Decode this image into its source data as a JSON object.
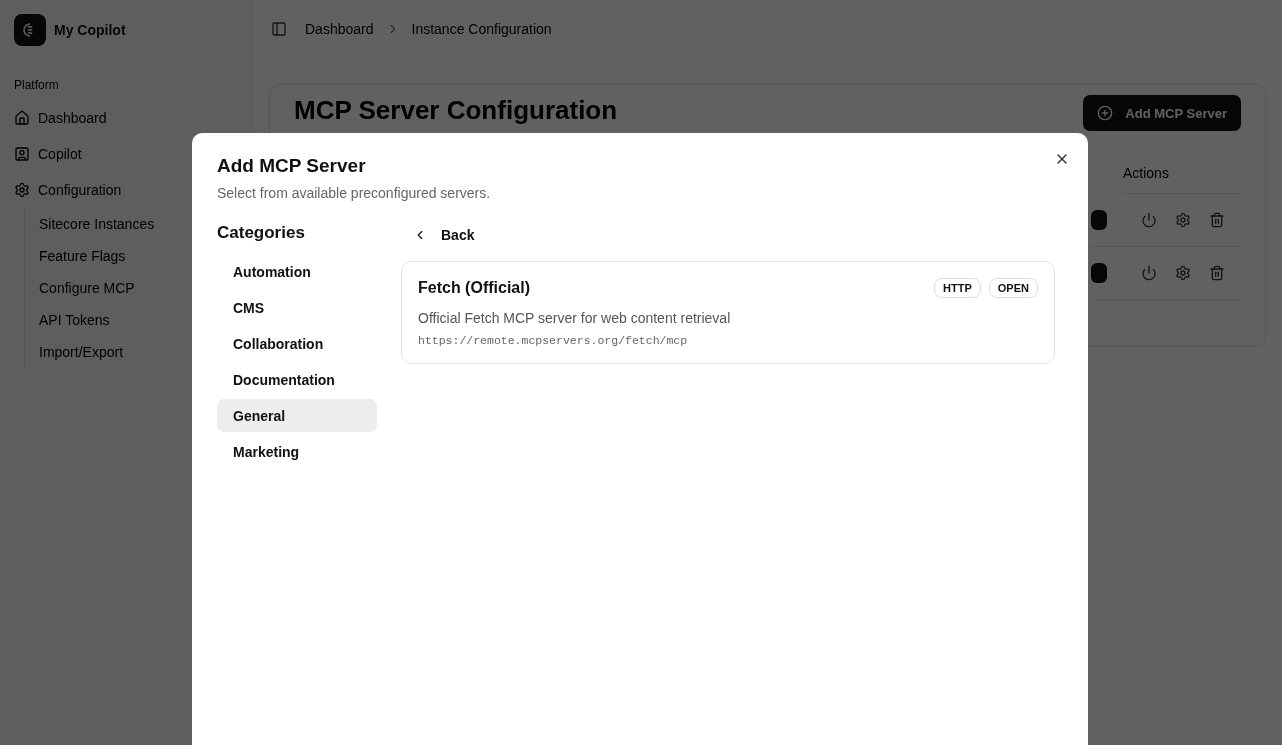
{
  "app": {
    "name": "My Copilot"
  },
  "sidebar": {
    "section": "Platform",
    "items": [
      {
        "label": "Dashboard"
      },
      {
        "label": "Copilot"
      },
      {
        "label": "Configuration",
        "children": [
          {
            "label": "Sitecore Instances"
          },
          {
            "label": "Feature Flags"
          },
          {
            "label": "Configure MCP"
          },
          {
            "label": "API Tokens"
          },
          {
            "label": "Import/Export"
          }
        ]
      }
    ]
  },
  "breadcrumb": [
    "Dashboard",
    "Instance Configuration"
  ],
  "page": {
    "title": "MCP Server Configuration",
    "add_button": "Add MCP Server",
    "table": {
      "columns": [
        "Actions"
      ],
      "rows": [
        {
          "on": true
        },
        {
          "on": true
        }
      ]
    }
  },
  "dialog": {
    "title": "Add MCP Server",
    "description": "Select from available preconfigured servers.",
    "categories_title": "Categories",
    "categories": [
      {
        "label": "Automation",
        "selected": false
      },
      {
        "label": "CMS",
        "selected": false
      },
      {
        "label": "Collaboration",
        "selected": false
      },
      {
        "label": "Documentation",
        "selected": false
      },
      {
        "label": "General",
        "selected": true
      },
      {
        "label": "Marketing",
        "selected": false
      }
    ],
    "back": "Back",
    "servers": [
      {
        "name": "Fetch (Official)",
        "tags": [
          "HTTP",
          "OPEN"
        ],
        "description": "Official Fetch MCP server for web content retrieval",
        "url": "https://remote.mcpservers.org/fetch/mcp"
      }
    ]
  }
}
